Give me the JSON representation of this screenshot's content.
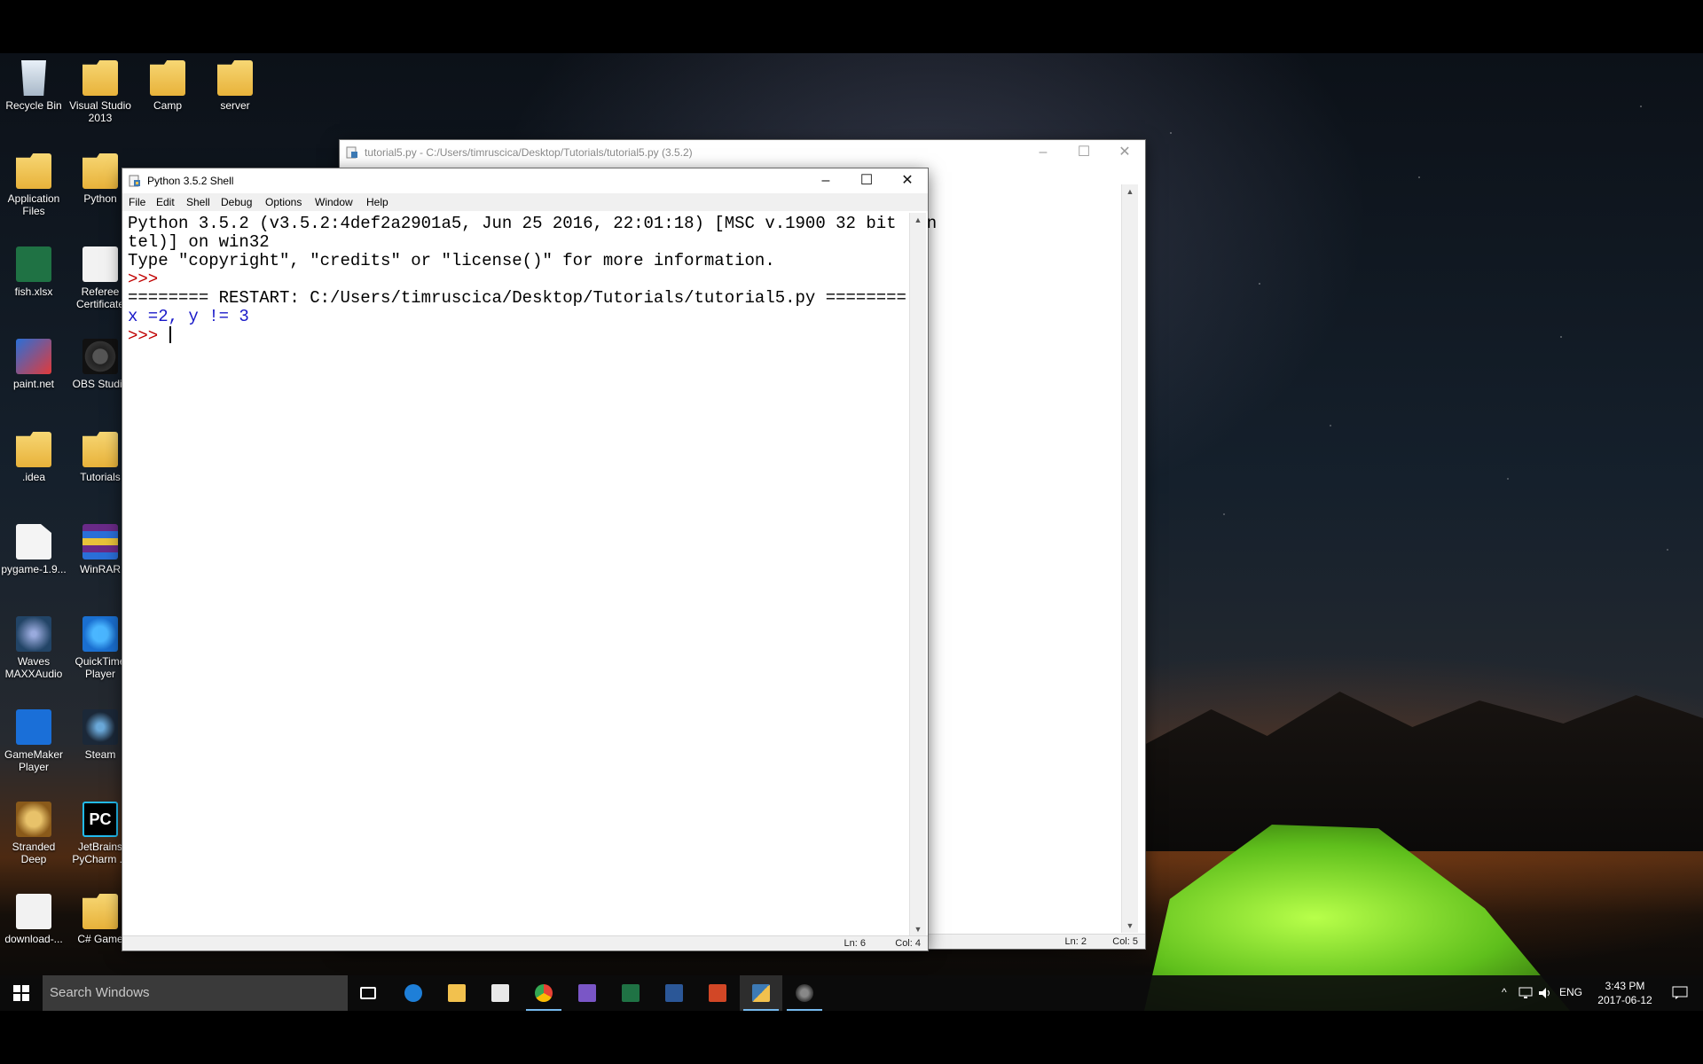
{
  "desktop": {
    "icons": [
      {
        "label": "Recycle Bin",
        "icon": "recycle-bin-icon"
      },
      {
        "label": "Visual Studio 2013",
        "icon": "folder-icon"
      },
      {
        "label": "Camp",
        "icon": "folder-icon"
      },
      {
        "label": "server",
        "icon": "folder-icon"
      },
      {
        "label": "Application Files",
        "icon": "folder-icon"
      },
      {
        "label": "Python",
        "icon": "folder-icon"
      },
      {
        "label": "fish.xlsx",
        "icon": "excel-file-icon"
      },
      {
        "label": "Referee Certificate",
        "icon": "document-icon"
      },
      {
        "label": "paint.net",
        "icon": "paintnet-icon"
      },
      {
        "label": "OBS Studio",
        "icon": "obs-icon"
      },
      {
        "label": ".idea",
        "icon": "folder-icon"
      },
      {
        "label": "Tutorials",
        "icon": "folder-icon"
      },
      {
        "label": "pygame-1.9...",
        "icon": "file-icon"
      },
      {
        "label": "WinRAR",
        "icon": "winrar-icon"
      },
      {
        "label": "Waves MAXXAudio",
        "icon": "waves-icon"
      },
      {
        "label": "QuickTime Player",
        "icon": "quicktime-icon"
      },
      {
        "label": "GameMaker Player",
        "icon": "gamemaker-icon"
      },
      {
        "label": "Steam",
        "icon": "steam-icon"
      },
      {
        "label": "Stranded Deep",
        "icon": "stranded-deep-icon"
      },
      {
        "label": "JetBrains PyCharm ...",
        "icon": "pycharm-icon"
      },
      {
        "label": "download-...",
        "icon": "image-file-icon"
      },
      {
        "label": "C# Game",
        "icon": "folder-icon"
      }
    ]
  },
  "editor_window": {
    "title": "tutorial5.py - C:/Users/timruscica/Desktop/Tutorials/tutorial5.py (3.5.2)",
    "status_ln": "Ln: 2",
    "status_col": "Col: 5",
    "controls": {
      "minimize": "–",
      "maximize": "☐",
      "close": "✕"
    }
  },
  "shell_window": {
    "title": "Python 3.5.2 Shell",
    "controls": {
      "minimize": "–",
      "maximize": "☐",
      "close": "✕"
    },
    "menu": [
      "File",
      "Edit",
      "Shell",
      "Debug",
      "Options",
      "Window",
      "Help"
    ],
    "lines": {
      "banner_1": "Python 3.5.2 (v3.5.2:4def2a2901a5, Jun 25 2016, 22:01:18) [MSC v.1900 32 bit (In",
      "banner_2": "tel)] on win32",
      "banner_3": "Type \"copyright\", \"credits\" or \"license()\" for more information.",
      "prompt_1": ">>>",
      "restart": "======== RESTART: C:/Users/timruscica/Desktop/Tutorials/tutorial5.py ========",
      "output": "x =2, y != 3",
      "prompt_2": ">>> "
    },
    "status_ln": "Ln: 6",
    "status_col": "Col: 4"
  },
  "taskbar": {
    "start_icon": "windows-logo-icon",
    "search_placeholder": "Search Windows",
    "apps": [
      {
        "name": "task-view",
        "color": "#ffffff"
      },
      {
        "name": "edge",
        "color": "#1e7fd8"
      },
      {
        "name": "file-explorer",
        "color": "#f2c14e"
      },
      {
        "name": "store",
        "color": "#e8e8e8"
      },
      {
        "name": "chrome",
        "color": "#e94235"
      },
      {
        "name": "visual-studio",
        "color": "#7a56c6"
      },
      {
        "name": "excel",
        "color": "#1f7244"
      },
      {
        "name": "word",
        "color": "#2b5797"
      },
      {
        "name": "powerpoint",
        "color": "#d24726"
      },
      {
        "name": "python-idle",
        "color": "#3d7ab5"
      },
      {
        "name": "obs",
        "color": "#9a9a9a"
      }
    ],
    "tray": {
      "chevron": "^",
      "language": "ENG",
      "time": "3:43 PM",
      "date": "2017-06-12"
    }
  }
}
